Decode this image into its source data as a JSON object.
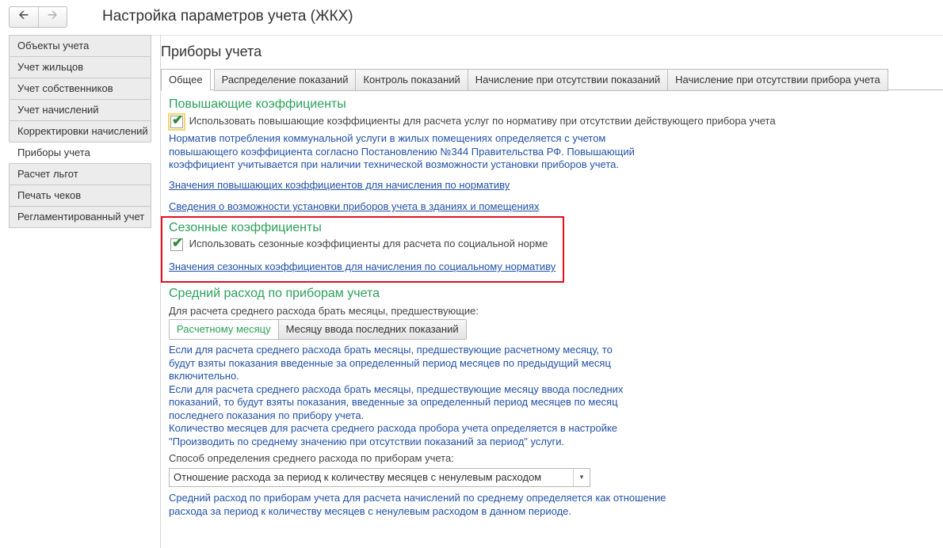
{
  "header": {
    "title": "Настройка параметров учета (ЖКХ)"
  },
  "sidebar": {
    "items": [
      {
        "label": "Объекты учета",
        "active": false
      },
      {
        "label": "Учет жильцов",
        "active": false
      },
      {
        "label": "Учет собственников",
        "active": false
      },
      {
        "label": "Учет начислений",
        "active": false
      },
      {
        "label": "Корректировки начислений",
        "active": false
      },
      {
        "label": "Приборы учета",
        "active": true
      },
      {
        "label": "Расчет льгот",
        "active": false
      },
      {
        "label": "Печать чеков",
        "active": false
      },
      {
        "label": "Регламентированный учет",
        "active": false
      }
    ]
  },
  "page": {
    "title": "Приборы учета"
  },
  "tabs": [
    {
      "label": "Общее",
      "active": true
    },
    {
      "label": "Распределение показаний",
      "active": false
    },
    {
      "label": "Контроль показаний",
      "active": false
    },
    {
      "label": "Начисление при отсутствии показаний",
      "active": false
    },
    {
      "label": "Начисление при отсутствии прибора учета",
      "active": false
    }
  ],
  "raising": {
    "title": "Повышающие коэффициенты",
    "checkbox_label": "Использовать повышающие коэффициенты для расчета услуг по нормативу при отсутствии действующего прибора учета",
    "checked": true,
    "hint": "Норматив потребления коммунальной услуги в жилых помещениях определяется с учетом повышающего коэффициента согласно Постановлению №344 Правительства РФ. Повышающий коэффициент учитывается при наличии технической возможности установки приборов учета.",
    "link1": "Значения повышающих коэффициентов для начисления по нормативу",
    "link2": "Сведения о возможности установки приборов учета в зданиях и помещениях"
  },
  "seasonal": {
    "title": "Сезонные коэффициенты",
    "checkbox_label": "Использовать сезонные коэффициенты для расчета по социальной норме",
    "checked": true,
    "link": "Значения сезонных коэффициентов для начисления по социальному нормативу"
  },
  "average": {
    "title": "Средний расход по приборам учета",
    "months_label": "Для расчета среднего расхода брать месяцы, предшествующие:",
    "toggle_active": "Расчетному месяцу",
    "toggle_other": "Месяцу ввода последних показаний",
    "hint": "Если для расчета среднего расхода брать месяцы, предшествующие расчетному месяцу, то будут взяты показания введенные за определенный период месяцев по предыдущий месяц включительно.\nЕсли для расчета среднего расхода брать месяцы, предшествующие месяцу ввода последних показаний, то будут взяты показания, введенные за определенный период месяцев по месяц последнего показания по прибору учета.\nКоличество месяцев для расчета среднего расхода пробора учета определяется в настройке \"Производить по среднему значению при отсутствии показаний за период\" услуги.",
    "method_label": "Способ определения среднего расхода по приборам учета:",
    "method_value": "Отношение расхода за период к количеству месяцев с ненулевым расходом",
    "method_hint": "Средний расход по приборам учета для расчета начислений по среднему определяется как отношение расхода за период к количеству месяцев с ненулевым расходом в данном периоде."
  },
  "colors": {
    "section_title": "#2ca05a",
    "hint": "#2251a8",
    "highlight_frame": "#e01020"
  }
}
